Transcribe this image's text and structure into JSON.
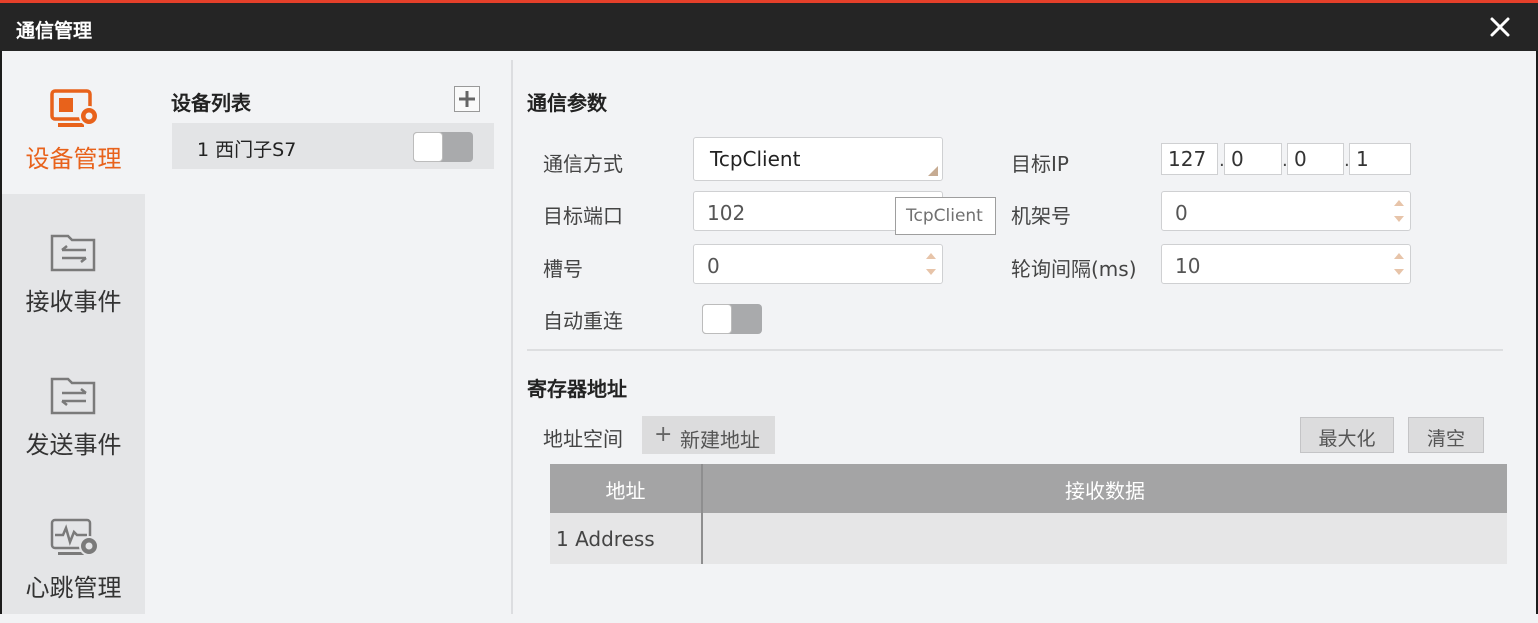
{
  "window": {
    "title": "通信管理"
  },
  "nav": {
    "items": [
      {
        "label": "设备管理",
        "icon": "device-manage-icon",
        "active": true
      },
      {
        "label": "接收事件",
        "icon": "receive-event-icon",
        "active": false
      },
      {
        "label": "发送事件",
        "icon": "send-event-icon",
        "active": false
      },
      {
        "label": "心跳管理",
        "icon": "heartbeat-icon",
        "active": false
      }
    ]
  },
  "device_list": {
    "header": "设备列表",
    "devices": [
      {
        "name": "1 西门子S7",
        "enabled": false
      }
    ]
  },
  "comm_params": {
    "title": "通信参数",
    "method_label": "通信方式",
    "method_value": "TcpClient",
    "method_tooltip": "TcpClient",
    "port_label": "目标端口",
    "port_value": "102",
    "slot_label": "槽号",
    "slot_value": "0",
    "auto_reconnect_label": "自动重连",
    "auto_reconnect_enabled": false,
    "ip_label": "目标IP",
    "ip_parts": [
      "127",
      "0",
      "0",
      "1"
    ],
    "rack_label": "机架号",
    "rack_value": "0",
    "poll_label": "轮询间隔(ms)",
    "poll_value": "10"
  },
  "registers": {
    "title": "寄存器地址",
    "space_label": "地址空间",
    "new_button": "新建地址",
    "maximize_button": "最大化",
    "clear_button": "清空",
    "columns": [
      "地址",
      "接收数据"
    ],
    "rows": [
      {
        "address": "1 Address",
        "data": ""
      }
    ]
  },
  "colors": {
    "accent": "#e8621b",
    "titlebar": "#252525",
    "top_line": "#e5402a"
  }
}
